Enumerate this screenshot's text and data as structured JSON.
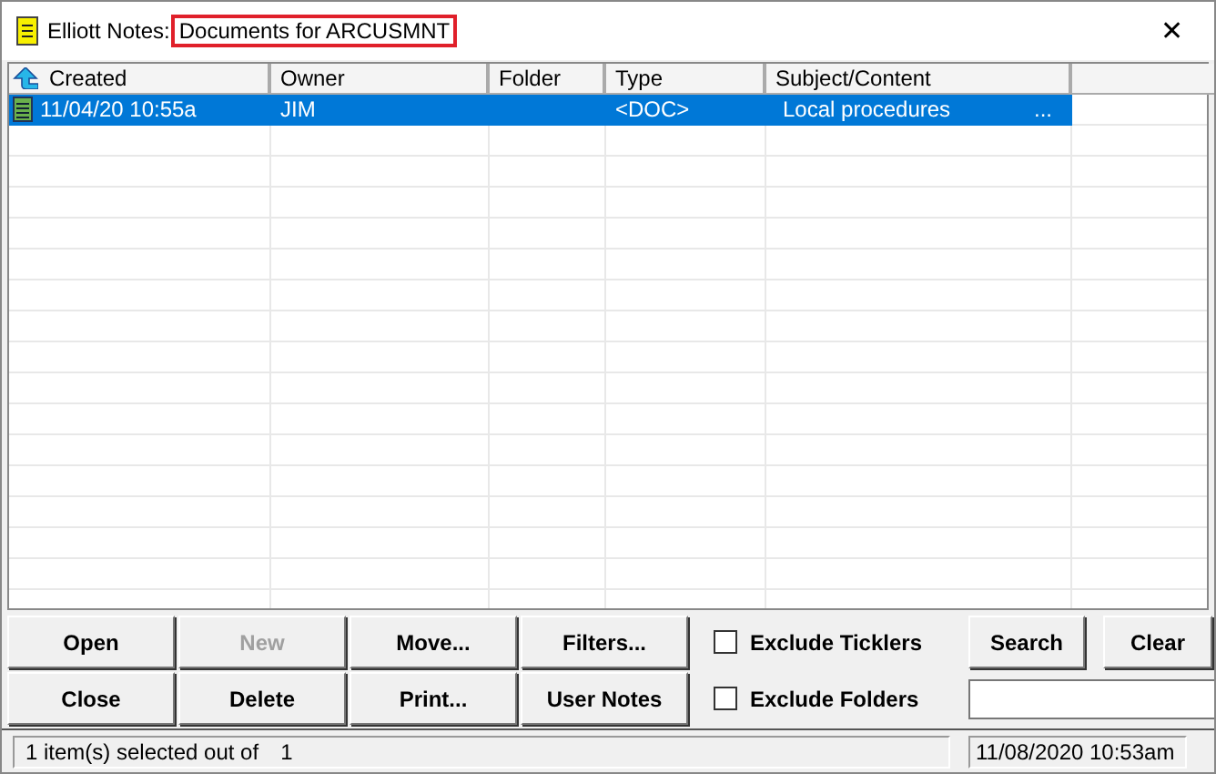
{
  "window": {
    "title": "Elliott Notes:",
    "subtitle": "Documents for ARCUSMNT",
    "close": "✕"
  },
  "table": {
    "columns": [
      "Created",
      "Owner",
      "Folder",
      "Type",
      "Subject/Content"
    ],
    "rows": [
      {
        "selected": true,
        "cells": [
          "11/04/20 10:55a",
          "JIM",
          "",
          "<DOC>",
          "Local procedures"
        ],
        "more": "..."
      }
    ]
  },
  "buttons": [
    {
      "label": "Open",
      "disabled": false
    },
    {
      "label": "New",
      "disabled": true
    },
    {
      "label": "Move...",
      "disabled": false
    },
    {
      "label": "Filters...",
      "disabled": false
    },
    {
      "label": "Close",
      "disabled": false
    },
    {
      "label": "Delete",
      "disabled": false
    },
    {
      "label": "Print...",
      "disabled": false
    },
    {
      "label": "User Notes",
      "disabled": false
    }
  ],
  "checkboxes": [
    {
      "label": "Exclude Ticklers",
      "checked": false
    },
    {
      "label": "Exclude Folders",
      "checked": false
    }
  ],
  "search": {
    "button": "Search",
    "clear": "Clear"
  },
  "status_bar": {
    "selection": "1 item(s) selected out of",
    "count": "1",
    "datetime": "11/08/2020 10:53am"
  }
}
